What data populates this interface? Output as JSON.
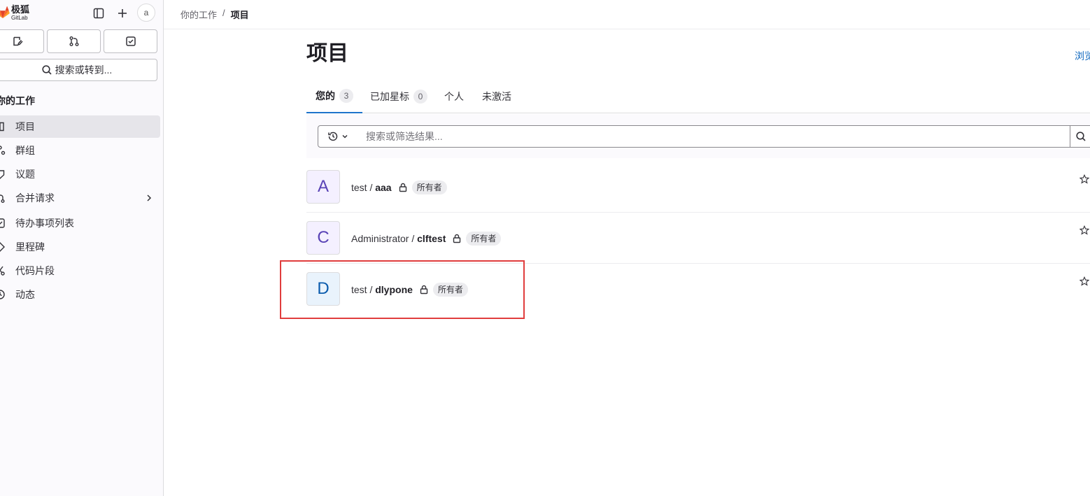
{
  "brand": {
    "name": "极狐",
    "sub": "GitLab",
    "fox_colors": [
      "#e24329",
      "#fc6d26",
      "#fca326"
    ]
  },
  "topbar": {
    "avatar_alt": "a"
  },
  "sidebar": {
    "search_label": "搜索或转到...",
    "section_title": "你的工作",
    "items": [
      {
        "label": "项目",
        "icon": "project-icon",
        "active": true
      },
      {
        "label": "群组",
        "icon": "group-icon"
      },
      {
        "label": "议题",
        "icon": "issues-icon"
      },
      {
        "label": "合并请求",
        "icon": "merge-request-icon",
        "has_chevron": true
      },
      {
        "label": "待办事项列表",
        "icon": "todo-icon"
      },
      {
        "label": "里程碑",
        "icon": "milestone-icon"
      },
      {
        "label": "代码片段",
        "icon": "snippet-icon"
      },
      {
        "label": "动态",
        "icon": "activity-icon"
      }
    ]
  },
  "breadcrumb": {
    "parent": "你的工作",
    "separator": "/",
    "current": "项目"
  },
  "page": {
    "title": "项目",
    "browse_link": "浏览"
  },
  "tabs": [
    {
      "label": "您的",
      "count": "3",
      "active": true
    },
    {
      "label": "已加星标",
      "count": "0"
    },
    {
      "label": "个人"
    },
    {
      "label": "未激活"
    }
  ],
  "filter": {
    "placeholder": "搜索或筛选结果..."
  },
  "projects": [
    {
      "avatar_letter": "A",
      "namespace": "test / ",
      "name": "aaa",
      "role": "所有者",
      "avatar_bg": "#f4f0ff",
      "avatar_color": "#5943b6"
    },
    {
      "avatar_letter": "C",
      "namespace": "Administrator / ",
      "name": "clftest",
      "role": "所有者",
      "avatar_bg": "#f4f0ff",
      "avatar_color": "#5943b6"
    },
    {
      "avatar_letter": "D",
      "namespace": "test / ",
      "name": "dlypone",
      "role": "所有者",
      "avatar_bg": "#e9f3fc",
      "avatar_color": "#0b5cad"
    }
  ],
  "colors": {
    "accent": "#1f75cb",
    "link": "#1068bf",
    "highlight": "#e03d3d"
  }
}
